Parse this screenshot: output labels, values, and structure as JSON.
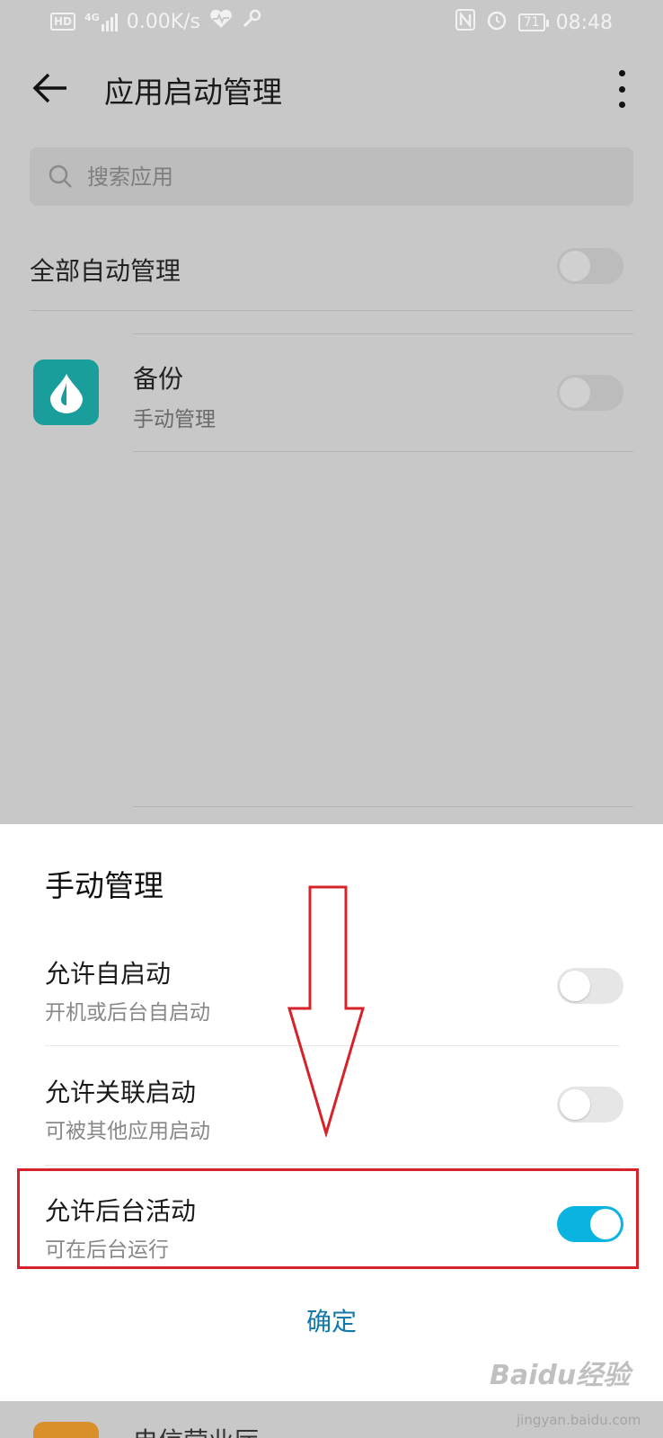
{
  "status_bar": {
    "hd_badge": "HD",
    "network": "4G",
    "speed": "0.00K/s",
    "battery": "71",
    "time": "08:48",
    "icons": [
      "signal-icon",
      "heart-monitor-icon",
      "key-icon",
      "nfc-icon",
      "alarm-icon",
      "battery-icon"
    ]
  },
  "header": {
    "title": "应用启动管理"
  },
  "search": {
    "placeholder": "搜索应用"
  },
  "global_toggle": {
    "label": "全部自动管理",
    "on": false
  },
  "apps": [
    {
      "name": "备份",
      "mode": "手动管理",
      "icon": "water-drop-icon",
      "icon_color": "#1a9e9c",
      "on": false
    }
  ],
  "sheet": {
    "title": "手动管理",
    "options": [
      {
        "title": "允许自启动",
        "subtitle": "开机或后台自启动",
        "on": false
      },
      {
        "title": "允许关联启动",
        "subtitle": "可被其他应用启动",
        "on": false
      },
      {
        "title": "允许后台活动",
        "subtitle": "可在后台运行",
        "on": true
      }
    ],
    "confirm_label": "确定"
  },
  "peek_app": {
    "name": "电信营业厅",
    "icon_color": "#d98f2a"
  },
  "watermark": {
    "text": "Baidu经验",
    "sub": "jingyan.baidu.com"
  },
  "colors": {
    "toggle_on": "#0ab4e0",
    "annotation_red": "#d6232a",
    "confirm_text": "#1478a8",
    "dim_overlay": "#c8c8c8"
  }
}
